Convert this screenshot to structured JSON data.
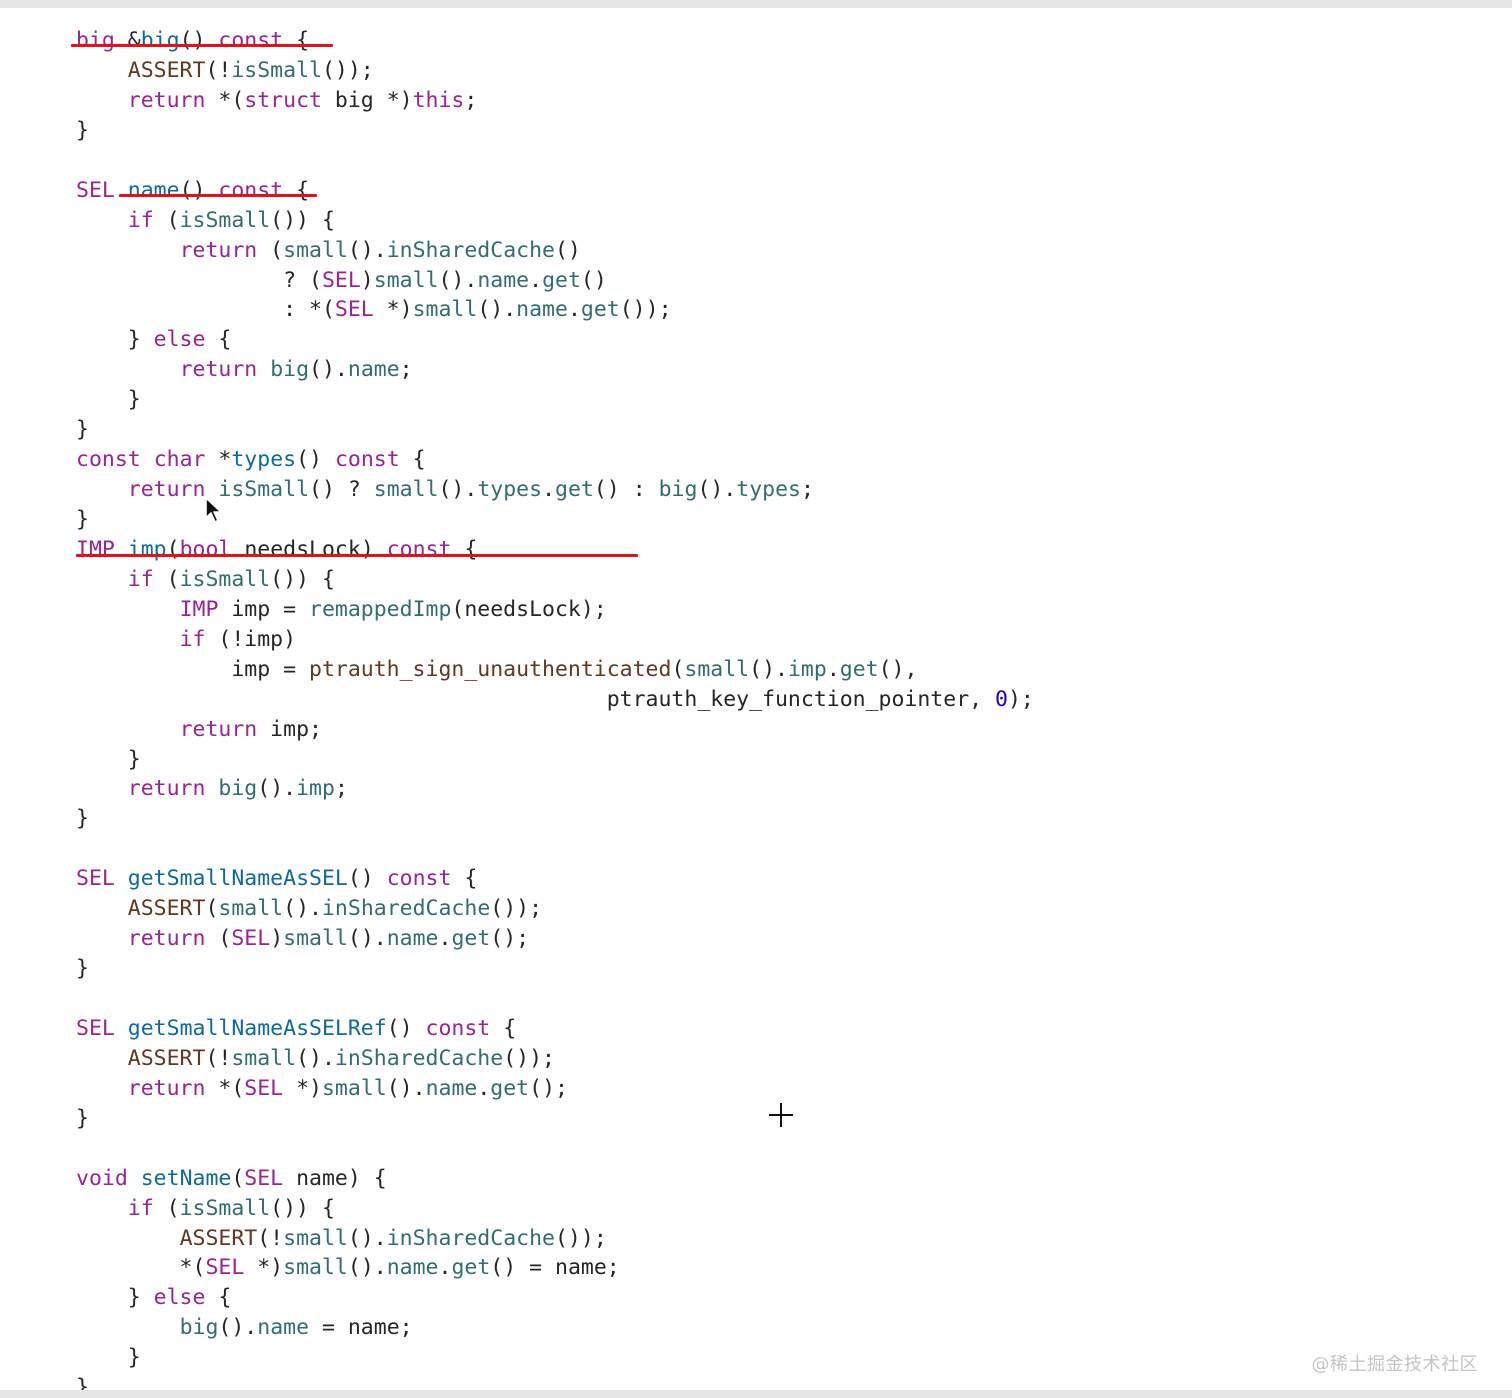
{
  "code": {
    "lines": [
      [
        [
          "big",
          "t-typ"
        ],
        [
          " &",
          "t-pl"
        ],
        [
          "big",
          "t-decl"
        ],
        [
          "() ",
          "t-pl"
        ],
        [
          "const",
          "t-kw"
        ],
        [
          " {",
          "t-pl"
        ]
      ],
      [
        [
          "    ",
          "t-pl"
        ],
        [
          "ASSERT",
          "t-mac"
        ],
        [
          "(!",
          "t-pl"
        ],
        [
          "isSmall",
          "t-fn"
        ],
        [
          "());",
          "t-pl"
        ]
      ],
      [
        [
          "    ",
          "t-pl"
        ],
        [
          "return",
          "t-kw"
        ],
        [
          " *(",
          "t-pl"
        ],
        [
          "struct",
          "t-kw"
        ],
        [
          " big *)",
          "t-pl"
        ],
        [
          "this",
          "t-kw"
        ],
        [
          ";",
          "t-pl"
        ]
      ],
      [
        [
          "}",
          "t-pl"
        ]
      ],
      [],
      [
        [
          "SEL",
          "t-typ"
        ],
        [
          " ",
          "t-pl"
        ],
        [
          "name",
          "t-decl"
        ],
        [
          "() ",
          "t-pl"
        ],
        [
          "const",
          "t-kw"
        ],
        [
          " {",
          "t-pl"
        ]
      ],
      [
        [
          "    ",
          "t-pl"
        ],
        [
          "if",
          "t-kw"
        ],
        [
          " (",
          "t-pl"
        ],
        [
          "isSmall",
          "t-fn"
        ],
        [
          "()) {",
          "t-pl"
        ]
      ],
      [
        [
          "        ",
          "t-pl"
        ],
        [
          "return",
          "t-kw"
        ],
        [
          " (",
          "t-pl"
        ],
        [
          "small",
          "t-fn"
        ],
        [
          "().",
          "t-pl"
        ],
        [
          "inSharedCache",
          "t-fn"
        ],
        [
          "()",
          "t-pl"
        ]
      ],
      [
        [
          "                ? (",
          "t-pl"
        ],
        [
          "SEL",
          "t-typ"
        ],
        [
          ")",
          "t-pl"
        ],
        [
          "small",
          "t-fn"
        ],
        [
          "().",
          "t-pl"
        ],
        [
          "name",
          "t-fn"
        ],
        [
          ".",
          "t-pl"
        ],
        [
          "get",
          "t-fn"
        ],
        [
          "()",
          "t-pl"
        ]
      ],
      [
        [
          "                : *(",
          "t-pl"
        ],
        [
          "SEL",
          "t-typ"
        ],
        [
          " *)",
          "t-pl"
        ],
        [
          "small",
          "t-fn"
        ],
        [
          "().",
          "t-pl"
        ],
        [
          "name",
          "t-fn"
        ],
        [
          ".",
          "t-pl"
        ],
        [
          "get",
          "t-fn"
        ],
        [
          "());",
          "t-pl"
        ]
      ],
      [
        [
          "    } ",
          "t-pl"
        ],
        [
          "else",
          "t-kw"
        ],
        [
          " {",
          "t-pl"
        ]
      ],
      [
        [
          "        ",
          "t-pl"
        ],
        [
          "return",
          "t-kw"
        ],
        [
          " ",
          "t-pl"
        ],
        [
          "big",
          "t-fn"
        ],
        [
          "().",
          "t-pl"
        ],
        [
          "name",
          "t-fn"
        ],
        [
          ";",
          "t-pl"
        ]
      ],
      [
        [
          "    }",
          "t-pl"
        ]
      ],
      [
        [
          "}",
          "t-pl"
        ]
      ],
      [
        [
          "const",
          "t-kw"
        ],
        [
          " ",
          "t-pl"
        ],
        [
          "char",
          "t-kw"
        ],
        [
          " *",
          "t-pl"
        ],
        [
          "types",
          "t-decl"
        ],
        [
          "() ",
          "t-pl"
        ],
        [
          "const",
          "t-kw"
        ],
        [
          " {",
          "t-pl"
        ]
      ],
      [
        [
          "    ",
          "t-pl"
        ],
        [
          "return",
          "t-kw"
        ],
        [
          " ",
          "t-pl"
        ],
        [
          "isSmall",
          "t-fn"
        ],
        [
          "() ? ",
          "t-pl"
        ],
        [
          "small",
          "t-fn"
        ],
        [
          "().",
          "t-pl"
        ],
        [
          "types",
          "t-fn"
        ],
        [
          ".",
          "t-pl"
        ],
        [
          "get",
          "t-fn"
        ],
        [
          "() : ",
          "t-pl"
        ],
        [
          "big",
          "t-fn"
        ],
        [
          "().",
          "t-pl"
        ],
        [
          "types",
          "t-fn"
        ],
        [
          ";",
          "t-pl"
        ]
      ],
      [
        [
          "}",
          "t-pl"
        ]
      ],
      [
        [
          "IMP",
          "t-typ"
        ],
        [
          " ",
          "t-pl"
        ],
        [
          "imp",
          "t-decl"
        ],
        [
          "(",
          "t-pl"
        ],
        [
          "bool",
          "t-kw"
        ],
        [
          " needsLock) ",
          "t-pl"
        ],
        [
          "const",
          "t-kw"
        ],
        [
          " {",
          "t-pl"
        ]
      ],
      [
        [
          "    ",
          "t-pl"
        ],
        [
          "if",
          "t-kw"
        ],
        [
          " (",
          "t-pl"
        ],
        [
          "isSmall",
          "t-fn"
        ],
        [
          "()) {",
          "t-pl"
        ]
      ],
      [
        [
          "        ",
          "t-pl"
        ],
        [
          "IMP",
          "t-typ"
        ],
        [
          " imp = ",
          "t-pl"
        ],
        [
          "remappedImp",
          "t-fn"
        ],
        [
          "(needsLock);",
          "t-pl"
        ]
      ],
      [
        [
          "        ",
          "t-pl"
        ],
        [
          "if",
          "t-kw"
        ],
        [
          " (!imp)",
          "t-pl"
        ]
      ],
      [
        [
          "            imp = ",
          "t-pl"
        ],
        [
          "ptrauth_sign_unauthenticated",
          "t-mac"
        ],
        [
          "(",
          "t-pl"
        ],
        [
          "small",
          "t-fn"
        ],
        [
          "().",
          "t-pl"
        ],
        [
          "imp",
          "t-fn"
        ],
        [
          ".",
          "t-pl"
        ],
        [
          "get",
          "t-fn"
        ],
        [
          "(),",
          "t-pl"
        ]
      ],
      [
        [
          "                                         ptrauth_key_function_pointer, ",
          "t-pl"
        ],
        [
          "0",
          "t-num"
        ],
        [
          ");",
          "t-pl"
        ]
      ],
      [
        [
          "        ",
          "t-pl"
        ],
        [
          "return",
          "t-kw"
        ],
        [
          " imp;",
          "t-pl"
        ]
      ],
      [
        [
          "    }",
          "t-pl"
        ]
      ],
      [
        [
          "    ",
          "t-pl"
        ],
        [
          "return",
          "t-kw"
        ],
        [
          " ",
          "t-pl"
        ],
        [
          "big",
          "t-fn"
        ],
        [
          "().",
          "t-pl"
        ],
        [
          "imp",
          "t-fn"
        ],
        [
          ";",
          "t-pl"
        ]
      ],
      [
        [
          "}",
          "t-pl"
        ]
      ],
      [],
      [
        [
          "SEL",
          "t-typ"
        ],
        [
          " ",
          "t-pl"
        ],
        [
          "getSmallNameAsSEL",
          "t-decl"
        ],
        [
          "() ",
          "t-pl"
        ],
        [
          "const",
          "t-kw"
        ],
        [
          " {",
          "t-pl"
        ]
      ],
      [
        [
          "    ",
          "t-pl"
        ],
        [
          "ASSERT",
          "t-mac"
        ],
        [
          "(",
          "t-pl"
        ],
        [
          "small",
          "t-fn"
        ],
        [
          "().",
          "t-pl"
        ],
        [
          "inSharedCache",
          "t-fn"
        ],
        [
          "());",
          "t-pl"
        ]
      ],
      [
        [
          "    ",
          "t-pl"
        ],
        [
          "return",
          "t-kw"
        ],
        [
          " (",
          "t-pl"
        ],
        [
          "SEL",
          "t-typ"
        ],
        [
          ")",
          "t-pl"
        ],
        [
          "small",
          "t-fn"
        ],
        [
          "().",
          "t-pl"
        ],
        [
          "name",
          "t-fn"
        ],
        [
          ".",
          "t-pl"
        ],
        [
          "get",
          "t-fn"
        ],
        [
          "();",
          "t-pl"
        ]
      ],
      [
        [
          "}",
          "t-pl"
        ]
      ],
      [],
      [
        [
          "SEL",
          "t-typ"
        ],
        [
          " ",
          "t-pl"
        ],
        [
          "getSmallNameAsSELRef",
          "t-decl"
        ],
        [
          "() ",
          "t-pl"
        ],
        [
          "const",
          "t-kw"
        ],
        [
          " {",
          "t-pl"
        ]
      ],
      [
        [
          "    ",
          "t-pl"
        ],
        [
          "ASSERT",
          "t-mac"
        ],
        [
          "(!",
          "t-pl"
        ],
        [
          "small",
          "t-fn"
        ],
        [
          "().",
          "t-pl"
        ],
        [
          "inSharedCache",
          "t-fn"
        ],
        [
          "());",
          "t-pl"
        ]
      ],
      [
        [
          "    ",
          "t-pl"
        ],
        [
          "return",
          "t-kw"
        ],
        [
          " *(",
          "t-pl"
        ],
        [
          "SEL",
          "t-typ"
        ],
        [
          " *)",
          "t-pl"
        ],
        [
          "small",
          "t-fn"
        ],
        [
          "().",
          "t-pl"
        ],
        [
          "name",
          "t-fn"
        ],
        [
          ".",
          "t-pl"
        ],
        [
          "get",
          "t-fn"
        ],
        [
          "();",
          "t-pl"
        ]
      ],
      [
        [
          "}",
          "t-pl"
        ]
      ],
      [],
      [
        [
          "void",
          "t-kw"
        ],
        [
          " ",
          "t-pl"
        ],
        [
          "setName",
          "t-decl"
        ],
        [
          "(",
          "t-pl"
        ],
        [
          "SEL",
          "t-typ"
        ],
        [
          " name) {",
          "t-pl"
        ]
      ],
      [
        [
          "    ",
          "t-pl"
        ],
        [
          "if",
          "t-kw"
        ],
        [
          " (",
          "t-pl"
        ],
        [
          "isSmall",
          "t-fn"
        ],
        [
          "()) {",
          "t-pl"
        ]
      ],
      [
        [
          "        ",
          "t-pl"
        ],
        [
          "ASSERT",
          "t-mac"
        ],
        [
          "(!",
          "t-pl"
        ],
        [
          "small",
          "t-fn"
        ],
        [
          "().",
          "t-pl"
        ],
        [
          "inSharedCache",
          "t-fn"
        ],
        [
          "());",
          "t-pl"
        ]
      ],
      [
        [
          "        *(",
          "t-pl"
        ],
        [
          "SEL",
          "t-typ"
        ],
        [
          " *)",
          "t-pl"
        ],
        [
          "small",
          "t-fn"
        ],
        [
          "().",
          "t-pl"
        ],
        [
          "name",
          "t-fn"
        ],
        [
          ".",
          "t-pl"
        ],
        [
          "get",
          "t-fn"
        ],
        [
          "() = name;",
          "t-pl"
        ]
      ],
      [
        [
          "    } ",
          "t-pl"
        ],
        [
          "else",
          "t-kw"
        ],
        [
          " {",
          "t-pl"
        ]
      ],
      [
        [
          "        ",
          "t-pl"
        ],
        [
          "big",
          "t-fn"
        ],
        [
          "().",
          "t-pl"
        ],
        [
          "name",
          "t-fn"
        ],
        [
          " = name;",
          "t-pl"
        ]
      ],
      [
        [
          "    }",
          "t-pl"
        ]
      ],
      [
        [
          "}",
          "t-pl"
        ]
      ]
    ],
    "highlighted_line": 9,
    "underlined_lines": [
      0,
      5,
      17
    ],
    "annotation_color": "#e5101a"
  },
  "cursor": {
    "icon": "arrow-pointer-icon"
  },
  "crosshair": {
    "icon": "crosshair-icon"
  },
  "watermark": {
    "text": "@稀土掘金技术社区"
  }
}
